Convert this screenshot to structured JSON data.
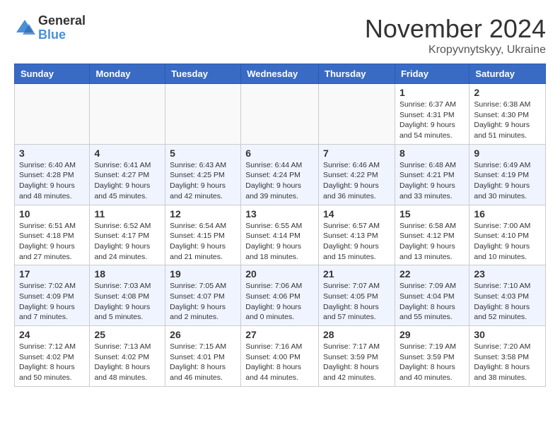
{
  "logo": {
    "general": "General",
    "blue": "Blue"
  },
  "title": "November 2024",
  "location": "Kropyvnytskyy, Ukraine",
  "weekdays": [
    "Sunday",
    "Monday",
    "Tuesday",
    "Wednesday",
    "Thursday",
    "Friday",
    "Saturday"
  ],
  "weeks": [
    [
      {
        "day": "",
        "info": ""
      },
      {
        "day": "",
        "info": ""
      },
      {
        "day": "",
        "info": ""
      },
      {
        "day": "",
        "info": ""
      },
      {
        "day": "",
        "info": ""
      },
      {
        "day": "1",
        "info": "Sunrise: 6:37 AM\nSunset: 4:31 PM\nDaylight: 9 hours\nand 54 minutes."
      },
      {
        "day": "2",
        "info": "Sunrise: 6:38 AM\nSunset: 4:30 PM\nDaylight: 9 hours\nand 51 minutes."
      }
    ],
    [
      {
        "day": "3",
        "info": "Sunrise: 6:40 AM\nSunset: 4:28 PM\nDaylight: 9 hours\nand 48 minutes."
      },
      {
        "day": "4",
        "info": "Sunrise: 6:41 AM\nSunset: 4:27 PM\nDaylight: 9 hours\nand 45 minutes."
      },
      {
        "day": "5",
        "info": "Sunrise: 6:43 AM\nSunset: 4:25 PM\nDaylight: 9 hours\nand 42 minutes."
      },
      {
        "day": "6",
        "info": "Sunrise: 6:44 AM\nSunset: 4:24 PM\nDaylight: 9 hours\nand 39 minutes."
      },
      {
        "day": "7",
        "info": "Sunrise: 6:46 AM\nSunset: 4:22 PM\nDaylight: 9 hours\nand 36 minutes."
      },
      {
        "day": "8",
        "info": "Sunrise: 6:48 AM\nSunset: 4:21 PM\nDaylight: 9 hours\nand 33 minutes."
      },
      {
        "day": "9",
        "info": "Sunrise: 6:49 AM\nSunset: 4:19 PM\nDaylight: 9 hours\nand 30 minutes."
      }
    ],
    [
      {
        "day": "10",
        "info": "Sunrise: 6:51 AM\nSunset: 4:18 PM\nDaylight: 9 hours\nand 27 minutes."
      },
      {
        "day": "11",
        "info": "Sunrise: 6:52 AM\nSunset: 4:17 PM\nDaylight: 9 hours\nand 24 minutes."
      },
      {
        "day": "12",
        "info": "Sunrise: 6:54 AM\nSunset: 4:15 PM\nDaylight: 9 hours\nand 21 minutes."
      },
      {
        "day": "13",
        "info": "Sunrise: 6:55 AM\nSunset: 4:14 PM\nDaylight: 9 hours\nand 18 minutes."
      },
      {
        "day": "14",
        "info": "Sunrise: 6:57 AM\nSunset: 4:13 PM\nDaylight: 9 hours\nand 15 minutes."
      },
      {
        "day": "15",
        "info": "Sunrise: 6:58 AM\nSunset: 4:12 PM\nDaylight: 9 hours\nand 13 minutes."
      },
      {
        "day": "16",
        "info": "Sunrise: 7:00 AM\nSunset: 4:10 PM\nDaylight: 9 hours\nand 10 minutes."
      }
    ],
    [
      {
        "day": "17",
        "info": "Sunrise: 7:02 AM\nSunset: 4:09 PM\nDaylight: 9 hours\nand 7 minutes."
      },
      {
        "day": "18",
        "info": "Sunrise: 7:03 AM\nSunset: 4:08 PM\nDaylight: 9 hours\nand 5 minutes."
      },
      {
        "day": "19",
        "info": "Sunrise: 7:05 AM\nSunset: 4:07 PM\nDaylight: 9 hours\nand 2 minutes."
      },
      {
        "day": "20",
        "info": "Sunrise: 7:06 AM\nSunset: 4:06 PM\nDaylight: 9 hours\nand 0 minutes."
      },
      {
        "day": "21",
        "info": "Sunrise: 7:07 AM\nSunset: 4:05 PM\nDaylight: 8 hours\nand 57 minutes."
      },
      {
        "day": "22",
        "info": "Sunrise: 7:09 AM\nSunset: 4:04 PM\nDaylight: 8 hours\nand 55 minutes."
      },
      {
        "day": "23",
        "info": "Sunrise: 7:10 AM\nSunset: 4:03 PM\nDaylight: 8 hours\nand 52 minutes."
      }
    ],
    [
      {
        "day": "24",
        "info": "Sunrise: 7:12 AM\nSunset: 4:02 PM\nDaylight: 8 hours\nand 50 minutes."
      },
      {
        "day": "25",
        "info": "Sunrise: 7:13 AM\nSunset: 4:02 PM\nDaylight: 8 hours\nand 48 minutes."
      },
      {
        "day": "26",
        "info": "Sunrise: 7:15 AM\nSunset: 4:01 PM\nDaylight: 8 hours\nand 46 minutes."
      },
      {
        "day": "27",
        "info": "Sunrise: 7:16 AM\nSunset: 4:00 PM\nDaylight: 8 hours\nand 44 minutes."
      },
      {
        "day": "28",
        "info": "Sunrise: 7:17 AM\nSunset: 3:59 PM\nDaylight: 8 hours\nand 42 minutes."
      },
      {
        "day": "29",
        "info": "Sunrise: 7:19 AM\nSunset: 3:59 PM\nDaylight: 8 hours\nand 40 minutes."
      },
      {
        "day": "30",
        "info": "Sunrise: 7:20 AM\nSunset: 3:58 PM\nDaylight: 8 hours\nand 38 minutes."
      }
    ]
  ]
}
